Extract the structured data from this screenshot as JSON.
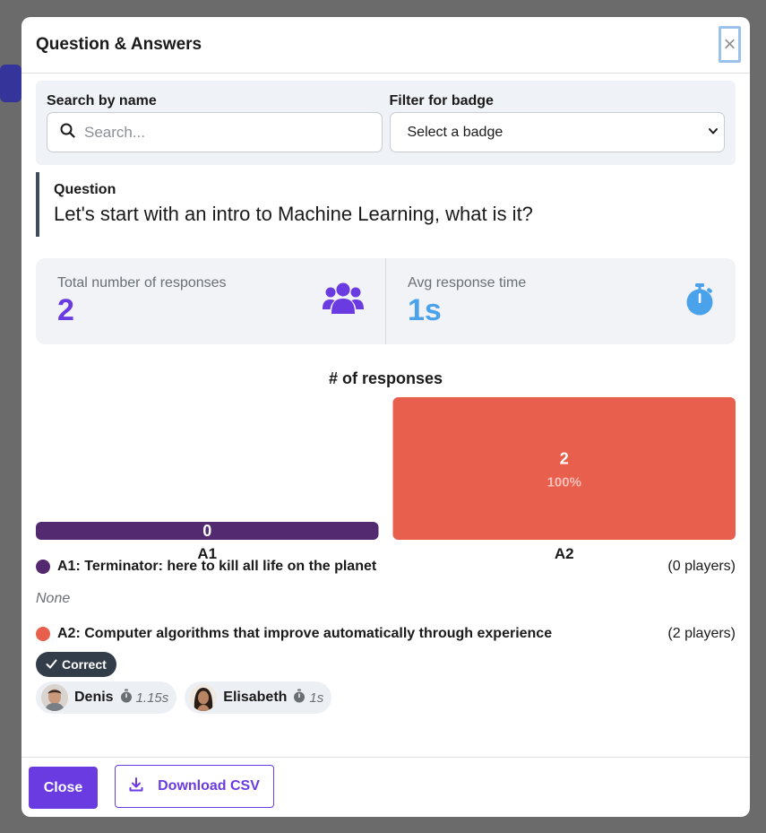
{
  "modal": {
    "title": "Question & Answers",
    "close_glyph": "×"
  },
  "filters": {
    "search_label": "Search by name",
    "search_placeholder": "Search...",
    "search_value": "",
    "badge_label": "Filter for badge",
    "badge_selected": "Select a badge"
  },
  "question": {
    "label": "Question",
    "text": "Let's start with an intro to Machine Learning, what is it?"
  },
  "stats": {
    "total_label": "Total number of responses",
    "total_value": "2",
    "avg_label": "Avg response time",
    "avg_value": "1s"
  },
  "chart_data": {
    "type": "bar",
    "title": "# of responses",
    "categories": [
      "A1",
      "A2"
    ],
    "values": [
      0,
      2
    ],
    "percent_labels": [
      "",
      "100%"
    ],
    "colors": [
      "#532a6f",
      "#e8604d"
    ],
    "ylim": [
      0,
      2
    ]
  },
  "answers": [
    {
      "text": "A1: Terminator: here to kill all life on the planet",
      "count": "(0 players)",
      "color": "#532a6f",
      "empty_text": "None"
    },
    {
      "text": "A2: Computer algorithms that improve automatically through experience",
      "count": "(2 players)",
      "color": "#e8604d",
      "badge": "Correct",
      "players": [
        {
          "name": "Denis",
          "time": "1.15s"
        },
        {
          "name": "Elisabeth",
          "time": "1s"
        }
      ]
    }
  ],
  "footer": {
    "close_label": "Close",
    "download_label": "Download CSV"
  }
}
